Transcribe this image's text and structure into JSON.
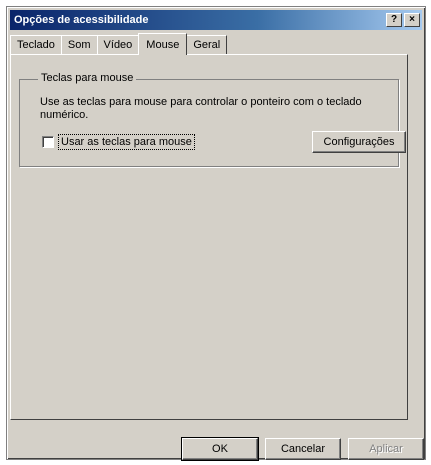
{
  "window": {
    "title": "Opções de acessibilidade",
    "help_button": "?",
    "close_button": "×"
  },
  "tabs": [
    {
      "label": "Teclado",
      "active": false
    },
    {
      "label": "Som",
      "active": false
    },
    {
      "label": "Vídeo",
      "active": false
    },
    {
      "label": "Mouse",
      "active": true
    },
    {
      "label": "Geral",
      "active": false
    }
  ],
  "mouse_keys": {
    "group_label": "Teclas para mouse",
    "description": "Use as teclas para mouse para controlar o ponteiro com o teclado numérico.",
    "checkbox_label": "Usar as teclas para mouse",
    "checkbox_checked": false,
    "settings_button": "Configurações"
  },
  "footer": {
    "ok": "OK",
    "cancel": "Cancelar",
    "apply": "Aplicar"
  }
}
